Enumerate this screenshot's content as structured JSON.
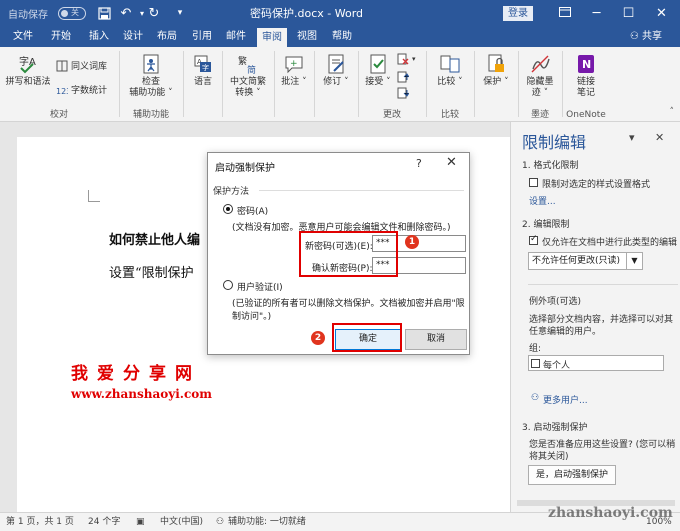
{
  "titlebar": {
    "autosave_label": "自动保存",
    "autosave_state": "关",
    "document_title": "密码保护.docx  -  Word",
    "login_label": "登录"
  },
  "tabs": [
    "文件",
    "开始",
    "插入",
    "设计",
    "布局",
    "引用",
    "邮件",
    "审阅",
    "视图",
    "帮助"
  ],
  "active_tab": "审阅",
  "share_label": "共享",
  "ribbon": {
    "proofing": {
      "spelling_label": "拼写和语法",
      "thesaurus_label": "同义词库",
      "wordcount_label": "字数统计",
      "group_label": "校对"
    },
    "accessibility": {
      "check_label": "检查",
      "check_label2": "辅助功能",
      "group_label": "辅助功能"
    },
    "language_label": "语言",
    "chinese_convert_label": "中文简繁",
    "chinese_convert_label2": "转换",
    "comments_label": "批注",
    "tracking_label": "修订",
    "accept_label": "接受",
    "changes_group_label": "更改",
    "compare_label": "比较",
    "compare_group_label": "比较",
    "protect_label": "保护",
    "hide_ink_label": "隐藏墨",
    "hide_ink_label2": "迹",
    "ink_group_label": "墨迹",
    "linked_notes_label": "链接",
    "linked_notes_label2": "笔记",
    "onenote_group_label": "OneNote",
    "onenote_logo": "N"
  },
  "document": {
    "heading": "如何禁止他人编",
    "paragraph": "设置“限制保护"
  },
  "watermark": {
    "text": "我爱分享网",
    "url": "www.zhanshaoyi.com"
  },
  "dialog": {
    "title": "启动强制保护",
    "help": "?",
    "close": "✕",
    "section_label": "保护方法",
    "password_option": "密码(A)",
    "password_note": "(文档没有加密。恶意用户可能会编辑文件和删除密码。)",
    "new_password_label": "新密码(可选)(E):",
    "new_password_value": "***",
    "confirm_password_label": "确认新密码(P):",
    "confirm_password_value": "***",
    "user_auth_option": "用户验证(I)",
    "user_auth_note_line1": "(已验证的所有者可以删除文档保护。文档被加密并启用\"限",
    "user_auth_note_line2": "制访问\"。)",
    "ok_label": "确定",
    "cancel_label": "取消"
  },
  "badges": [
    "1",
    "2"
  ],
  "pane": {
    "title": "限制编辑",
    "section1": "1. 格式化限制",
    "format_restrict": "限制对选定的样式设置格式",
    "settings_link": "设置...",
    "section2": "2. 编辑限制",
    "edit_restrict": "仅允许在文档中进行此类型的编辑",
    "edit_mode": "不允许任何更改(只读)",
    "exceptions_title": "例外项(可选)",
    "exceptions_desc1": "选择部分文档内容，并选择可以对其",
    "exceptions_desc2": "任意编辑的用户。",
    "groups_label": "组:",
    "everyone": "每个人",
    "more_users_link": "更多用户...",
    "section3": "3. 启动强制保护",
    "apply_q1": "您是否准备应用这些设置? (您可以稍",
    "apply_q2": "将其关闭)",
    "start_button": "是，启动强制保护"
  },
  "statusbar": {
    "page": "第 1 页，共 1 页",
    "words": "24 个字",
    "language": "中文(中国)",
    "accessibility": "辅助功能: 一切就绪",
    "zoom": "100%"
  },
  "site_watermark": "zhanshaoyi.com",
  "colors": {
    "word_blue": "#2b579a",
    "annotation_red": "#e00000",
    "watermark_red": "#e00000"
  }
}
